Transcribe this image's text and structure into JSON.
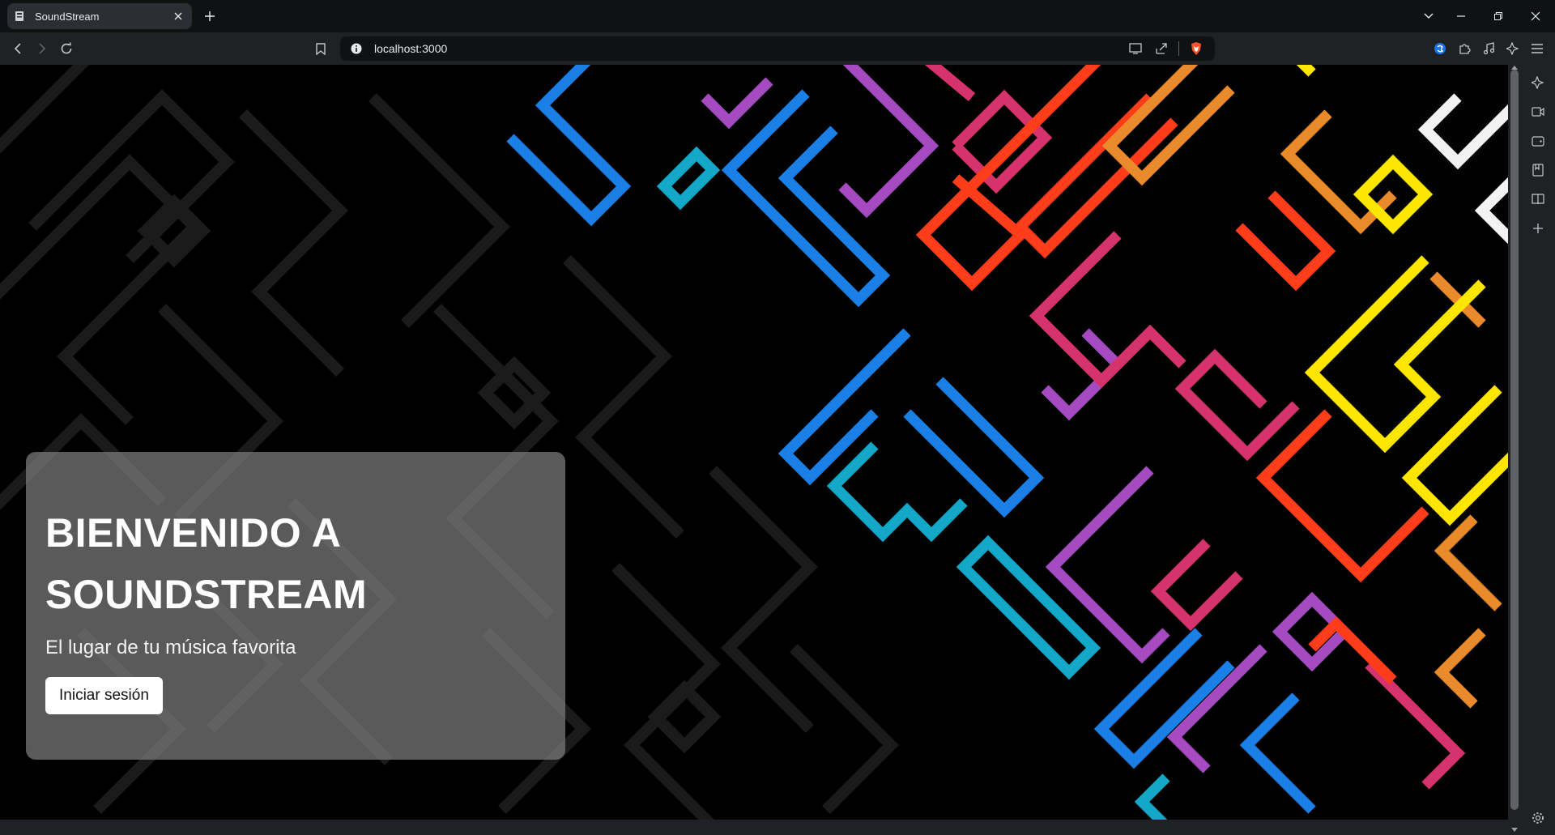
{
  "browser": {
    "tab": {
      "title": "SoundStream"
    },
    "address_bar": {
      "url": "localhost:3000"
    }
  },
  "icons": {
    "back": "arrow-left-icon",
    "forward": "arrow-right-icon",
    "reload": "reload-icon",
    "bookmark": "bookmark-icon",
    "site_info": "info-icon",
    "cast": "cast-icon",
    "share": "share-icon",
    "brave": "brave-shields-icon",
    "extensions": "puzzle-icon",
    "music": "music-icon",
    "leo": "sparkle-icon",
    "menu": "hamburger-icon",
    "settings": "gear-icon"
  },
  "hero": {
    "title_line1": "BIENVENIDO A",
    "title_line2": "SOUNDSTREAM",
    "subtitle": "El lugar de tu música favorita",
    "login_button": "Iniciar sesión"
  },
  "colors": {
    "chrome_dark": "#0f1113",
    "chrome": "#1f2124",
    "card": "rgba(125,125,125,0.72)",
    "maze_blue": "#1a7fe6",
    "maze_cyan": "#14a8c8",
    "maze_purple": "#a54ac0",
    "maze_magenta": "#d6336c",
    "maze_red": "#ff3d1a",
    "maze_orange": "#ea8a2a",
    "maze_yellow": "#ffe600",
    "maze_white": "#f2f2f2"
  }
}
